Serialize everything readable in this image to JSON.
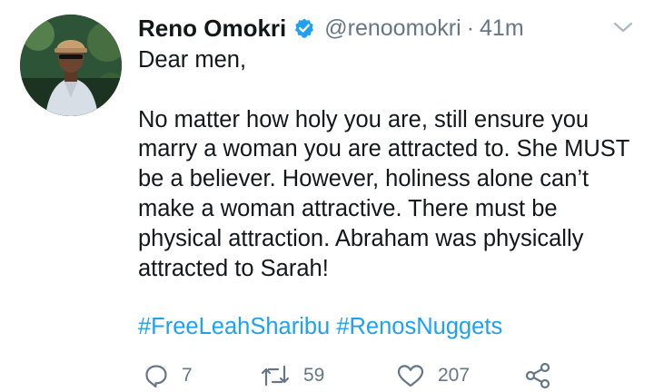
{
  "tweet": {
    "author": {
      "display_name": "Reno Omokri",
      "handle": "@renoomokri",
      "verified": true,
      "avatar_icon": "profile-photo"
    },
    "separator": "·",
    "timestamp": "41m",
    "body": {
      "greeting": "Dear men,",
      "paragraph": "No matter how holy you are, still ensure you marry a woman you are attracted to. She MUST be a believer. However, holiness alone can’t make a woman attractive. There must be physical attraction. Abraham was physically attracted to Sarah!"
    },
    "hashtags": [
      "#FreeLeahSharibu",
      "#RenosNuggets"
    ],
    "actions": {
      "reply": {
        "icon": "reply-icon",
        "count": "7"
      },
      "retweet": {
        "icon": "retweet-icon",
        "count": "59"
      },
      "like": {
        "icon": "heart-icon",
        "count": "207"
      },
      "share": {
        "icon": "share-icon"
      }
    }
  },
  "colors": {
    "text": "#14171a",
    "secondary": "#657786",
    "link": "#1da1f2",
    "verified": "#1da1f2"
  }
}
